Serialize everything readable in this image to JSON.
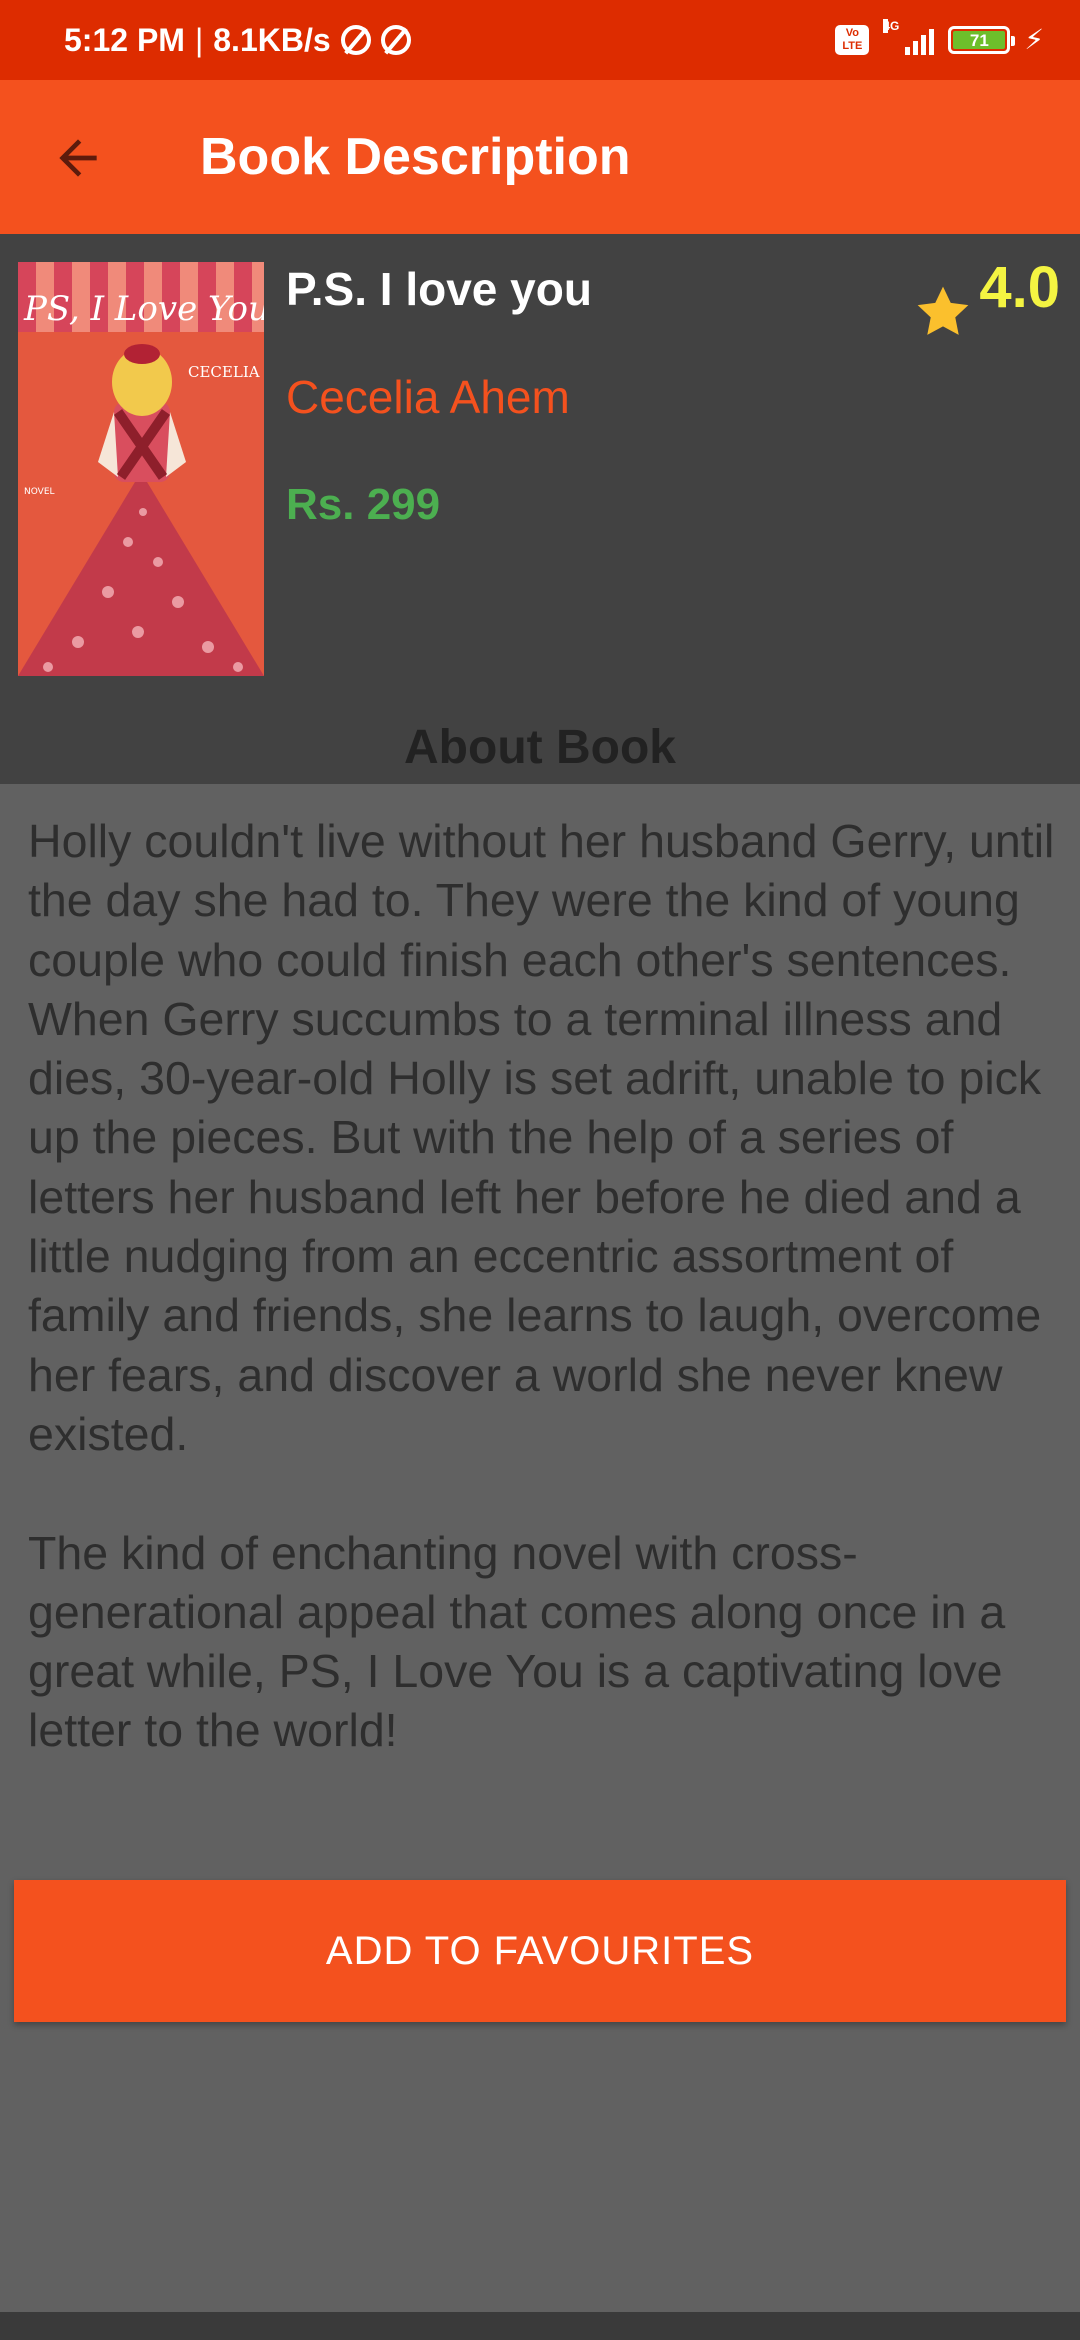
{
  "status_bar": {
    "time": "5:12 PM",
    "network_speed": "8.1KB/s",
    "volte_label": "Vo LTE",
    "network_type": "4G",
    "battery_level": "71",
    "battery_percent": 71
  },
  "app_bar": {
    "back_icon": "arrow-back-icon",
    "title": "Book Description"
  },
  "book": {
    "title": "P.S. I love you",
    "author": "Cecelia Ahem",
    "price": "Rs. 299",
    "rating": "4.0",
    "rating_icon": "star-icon",
    "cover": {
      "title_text": "PS, I Love You",
      "author_text": "CECELIA AHERN",
      "label_text": "NOVEL"
    }
  },
  "about": {
    "heading": "About Book",
    "paragraphs": [
      "Holly couldn't live without her husband Gerry, until the day she had to. They were the kind of young couple who could finish each other's sentences. When Gerry succumbs to a terminal illness and dies, 30-year-old Holly is set adrift, unable to pick up the pieces. But with the help of a series of letters her husband left her before he died and a little nudging from an eccentric assortment of family and friends, she learns to laugh, overcome her fears, and discover a world she never knew existed.",
      "The kind of enchanting novel with cross-generational appeal that comes along once in a great while, PS, I Love You is a captivating love letter to the world!"
    ]
  },
  "actions": {
    "favourite_label": "ADD TO FAVOURITES"
  },
  "colors": {
    "status_bar": "#DD2C00",
    "app_bar": "#F4511E",
    "header_bg": "#424242",
    "body_bg": "#616161",
    "author": "#F4511E",
    "price": "#4CAF50",
    "rating": "#F4F442",
    "star": "#FBC02D"
  }
}
